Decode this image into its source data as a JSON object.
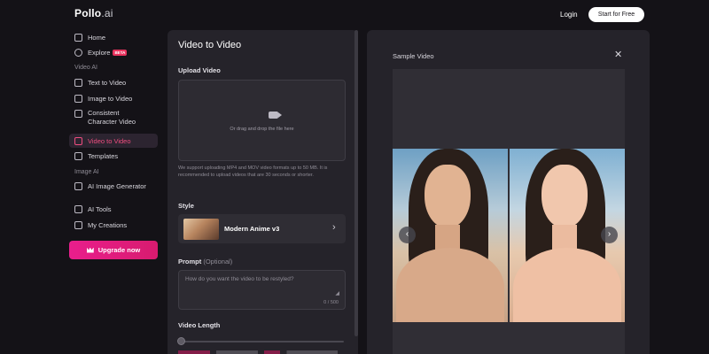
{
  "header": {
    "logo_main": "Pollo",
    "logo_suffix": ".ai",
    "login_label": "Login",
    "start_label": "Start for Free"
  },
  "sidebar": {
    "items_top": [
      {
        "label": "Home",
        "icon": "home-icon"
      },
      {
        "label": "Explore",
        "icon": "compass-icon",
        "badge": "BETA"
      }
    ],
    "section_video": "Video AI",
    "items_video": [
      {
        "label": "Text to Video",
        "icon": "text-doc-icon"
      },
      {
        "label": "Image to Video",
        "icon": "image-icon"
      },
      {
        "label": "Consistent Character Video",
        "icon": "character-icon"
      },
      {
        "label": "Video to Video",
        "icon": "video-icon",
        "active": true
      },
      {
        "label": "Templates",
        "icon": "template-icon"
      }
    ],
    "section_image": "Image AI",
    "items_image": [
      {
        "label": "AI Image Generator",
        "icon": "image-gen-icon"
      }
    ],
    "items_bottom": [
      {
        "label": "AI Tools",
        "icon": "tools-icon"
      },
      {
        "label": "My Creations",
        "icon": "creations-icon"
      }
    ],
    "upgrade_label": "Upgrade now",
    "active_color": "#ef4d7f"
  },
  "panel": {
    "title": "Video to Video",
    "upload_label": "Upload Video",
    "upload_hint": "Or drag and drop the file here",
    "support_text": "We support uploading MP4 and MOV video formats up to 50 MB. It is recommended to upload videos that are 30 seconds or shorter.",
    "style_label": "Style",
    "style_value": "Modern Anime v3",
    "prompt_label": "Prompt",
    "prompt_optional": "(Optional)",
    "prompt_placeholder": "How do you want the video to be restyled?",
    "prompt_count": "0 / 500",
    "length_label": "Video Length"
  },
  "sample": {
    "title": "Sample Video",
    "close_icon": "close-icon",
    "prev_icon": "chevron-left-icon",
    "next_icon": "chevron-right-icon"
  },
  "colors": {
    "background": "#141217",
    "panel": "#25232a",
    "accent": "#e91e8c"
  }
}
